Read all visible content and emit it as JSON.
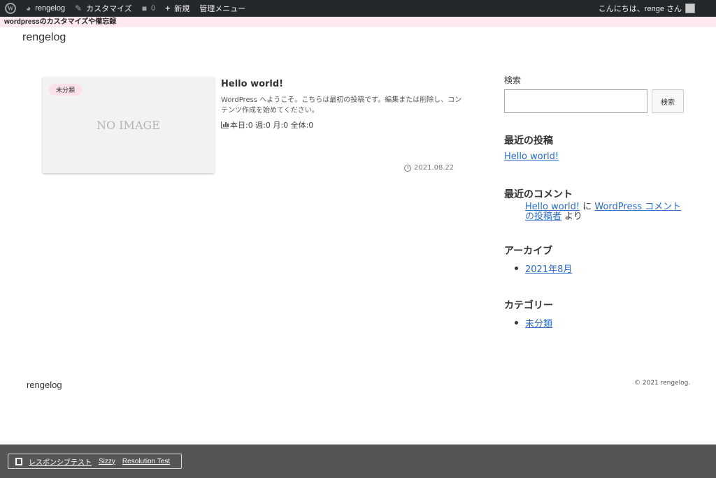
{
  "adminbar": {
    "site": "rengelog",
    "customize": "カスタマイズ",
    "comments_count": "0",
    "new": "新規",
    "admin_menu": "管理メニュー",
    "greeting": "こんにちは、renge さん"
  },
  "notice": "wordpressのカスタマイズや備忘録",
  "site_title": "rengelog",
  "post": {
    "category": "未分類",
    "no_image": "NO IMAGE",
    "title": "Hello world!",
    "excerpt": "WordPress へようこそ。こちらは最初の投稿です。編集または削除し、コンテンツ作成を始めてください。",
    "stats": "本日:0 週:0 月:0 全体:0",
    "date": "2021.08.22"
  },
  "sidebar": {
    "search_label": "検索",
    "search_button": "検索",
    "recent_posts_heading": "最近の投稿",
    "recent_post": "Hello world!",
    "recent_comments_heading": "最近のコメント",
    "comment_post": "Hello world!",
    "comment_sep": " に ",
    "comment_author": "WordPress コメントの投稿者",
    "comment_suffix": " より",
    "archives_heading": "アーカイブ",
    "archive_item": "2021年8月",
    "categories_heading": "カテゴリー",
    "category_item": "未分類"
  },
  "footer": {
    "title": "rengelog",
    "copyright": "© 2021 rengelog."
  },
  "bottom_bar": {
    "responsive_test": "レスポンシブテスト",
    "sizzy": "Sizzy",
    "resolution_test": "Resolution Test"
  }
}
